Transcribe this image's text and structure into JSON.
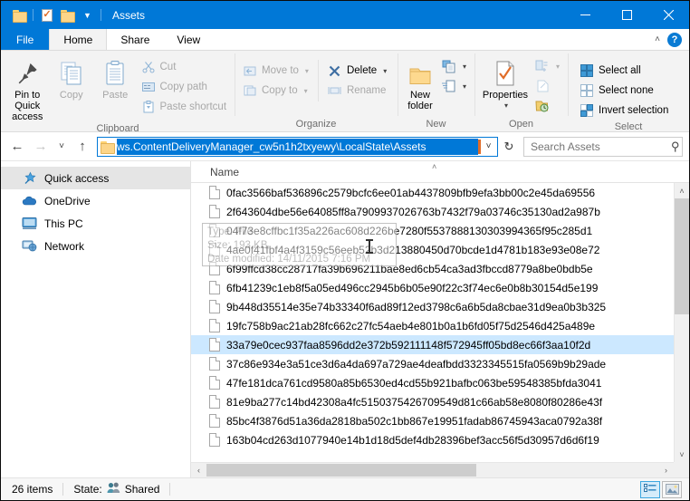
{
  "window": {
    "title": "Assets",
    "quick_access_toolbar": [
      {
        "name": "folder-properties-icon",
        "label": "Properties"
      },
      {
        "name": "checkmark-properties-icon",
        "label": "Properties"
      },
      {
        "name": "new-folder-icon",
        "label": "New folder"
      },
      {
        "name": "customize-dropdown-icon",
        "label": "Customize Quick Access Toolbar"
      }
    ],
    "controls": {
      "minimize": "—",
      "maximize": "☐",
      "close": "✕"
    }
  },
  "tabs": {
    "file": "File",
    "items": [
      {
        "label": "Home",
        "active": true
      },
      {
        "label": "Share",
        "active": false
      },
      {
        "label": "View",
        "active": false
      }
    ],
    "collapse_icon": "˄",
    "help_icon": "?"
  },
  "ribbon": {
    "groups": [
      {
        "label": "Clipboard",
        "big_buttons": [
          {
            "label": "Pin to Quick\naccess",
            "line1": "Pin to Quick",
            "line2": "access",
            "dim": false
          },
          {
            "label": "Copy",
            "dim": true
          },
          {
            "label": "Paste",
            "dim": true
          }
        ],
        "small_buttons": [
          {
            "label": "Cut",
            "dim": true,
            "icon": "scissors-icon"
          },
          {
            "label": "Copy path",
            "dim": true,
            "icon": "copy-path-icon"
          },
          {
            "label": "Paste shortcut",
            "dim": true,
            "icon": "paste-shortcut-icon"
          }
        ]
      },
      {
        "label": "Organize",
        "small_buttons": [
          {
            "label": "Move to",
            "dim": true,
            "icon": "move-to-icon",
            "caret": "▾"
          },
          {
            "label": "Copy to",
            "dim": true,
            "icon": "copy-to-icon",
            "caret": "▾"
          },
          {
            "label": "Delete",
            "dim": false,
            "icon": "delete-x-icon",
            "caret": "▾"
          },
          {
            "label": "Rename",
            "dim": true,
            "icon": "rename-icon"
          }
        ]
      },
      {
        "label": "New",
        "big_buttons": [
          {
            "line1": "New",
            "line2": "folder",
            "label": "New folder",
            "dim": false
          }
        ],
        "small_buttons": [
          {
            "label": "",
            "dim": false,
            "icon": "new-item-icon",
            "caret": "▾"
          },
          {
            "label": "",
            "dim": false,
            "icon": "easy-access-icon",
            "caret": "▾"
          }
        ]
      },
      {
        "label": "Open",
        "big_buttons": [
          {
            "line1": "Properties",
            "line2": "▾",
            "label": "Properties",
            "dim": false
          }
        ],
        "small_buttons": [
          {
            "label": "",
            "dim": true,
            "icon": "open-with-icon",
            "caret": "▾"
          },
          {
            "label": "",
            "dim": true,
            "icon": "edit-icon"
          },
          {
            "label": "",
            "dim": false,
            "icon": "history-icon"
          }
        ]
      },
      {
        "label": "Select",
        "small_buttons": [
          {
            "label": "Select all",
            "dim": false,
            "icon": "select-all-icon"
          },
          {
            "label": "Select none",
            "dim": false,
            "icon": "select-none-icon"
          },
          {
            "label": "Invert selection",
            "dim": false,
            "icon": "invert-selection-icon"
          }
        ]
      }
    ]
  },
  "addressbar": {
    "back_icon": "←",
    "forward_icon": "→",
    "recent_icon": "˅",
    "up_icon": "↑",
    "path_text": "ws.ContentDeliveryManager_cw5n1h2txyewy\\LocalState\\Assets",
    "path_selected": true,
    "dropdown_icon": "˅",
    "refresh_icon": "↻",
    "search": {
      "placeholder": "Search Assets",
      "value": "",
      "icon": "search-icon"
    }
  },
  "sidebar": {
    "items": [
      {
        "label": "Quick access",
        "icon": "star-pin-icon",
        "selected": true
      },
      {
        "label": "OneDrive",
        "icon": "cloud-icon",
        "selected": false
      },
      {
        "label": "This PC",
        "icon": "monitor-icon",
        "selected": false
      },
      {
        "label": "Network",
        "icon": "network-icon",
        "selected": false
      }
    ]
  },
  "filelist": {
    "column_header": "Name",
    "sort_indicator": "˄",
    "rows": [
      {
        "name": "0fac3566baf536896c2579bcfc6ee01ab4437809bfb9efa3bb00c2e45da69556",
        "selected": false
      },
      {
        "name": "2f643604dbe56e64085ff8a7909937026763b7432f79a03746c35130ad2a987b",
        "selected": false
      },
      {
        "name": "04f73e8cffbc1f35a226ac608d226be7280f5537888130303994365f95c285d1",
        "selected": false
      },
      {
        "name": "4ae0f41fbf4a4f3159c56eeb52b3d213880450d70bcde1d4781b183e93e08e72",
        "selected": false
      },
      {
        "name": "6f99ffcd38cc28717fa39b696211bae8ed6cb54ca3ad3fbccd8779a8be0bdb5e",
        "selected": false
      },
      {
        "name": "6fb41239c1eb8f5a05ed496cc2945b6b05e90f22c3f74ec6e0b8b30154d5e199",
        "selected": false
      },
      {
        "name": "9b448d35514e35e74b33340f6ad89f12ed3798c6a6b5da8cbae31d9ea0b3b325",
        "selected": false
      },
      {
        "name": "19fc758b9ac21ab28fc662c27fc54aeb4e801b0a1b6fd05f75d2546d425a489e",
        "selected": false
      },
      {
        "name": "33a79e0cec937faa8596dd2e372b592111148f572945ff05bd8ec66f3aa10f2d",
        "selected": true
      },
      {
        "name": "37c86e934e3a51ce3d6a4da697a729ae4deafbdd3323345515fa0569b9b29ade",
        "selected": false
      },
      {
        "name": "47fe181dca761cd9580a85b6530ed4cd55b921bafbc063be59548385bfda3041",
        "selected": false
      },
      {
        "name": "81e9ba277c14bd42308a4fc5150375426709549d81c66ab58e8080f80286e43f",
        "selected": false
      },
      {
        "name": "85bc4f3876d51a36da2818ba502c1bb867e19951fadab86745943aca0792a38f",
        "selected": false
      },
      {
        "name": "163b04cd263d1077940e14b1d18d5def4db28396bef3acc56f5d30957d6d6f19",
        "selected": false
      }
    ],
    "tooltip": {
      "line1": "Type: File",
      "line2": "Size: 193 KB",
      "line3": "Date modified: 14/11/2015 7:16 PM"
    }
  },
  "statusbar": {
    "item_count": "26 items",
    "state_label": "State:",
    "state_value": "Shared",
    "state_icon": "shared-people-icon",
    "view_buttons": [
      {
        "name": "details-view-button",
        "active": true
      },
      {
        "name": "large-icons-view-button",
        "active": false
      }
    ]
  },
  "scrollbars": {
    "vertical": {
      "up": "˄",
      "down": "˅"
    },
    "horizontal": {
      "left": "‹",
      "right": "›"
    }
  }
}
